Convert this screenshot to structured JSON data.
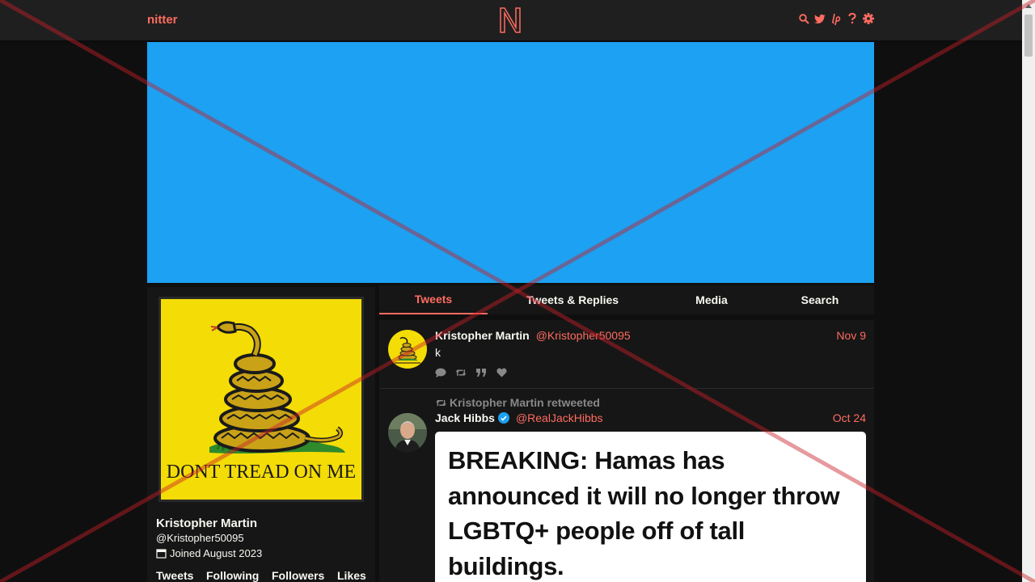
{
  "navbar": {
    "brand": "nitter",
    "icons": [
      "search-icon",
      "twitter-bird-icon",
      "liberapay-icon",
      "help-icon",
      "settings-gear-icon"
    ]
  },
  "banner": {
    "color": "#1da1f2"
  },
  "profile": {
    "avatar_caption": "DONT TREAD ON ME",
    "fullname": "Kristopher Martin",
    "username": "@Kristopher50095",
    "joined": "Joined August 2023",
    "stats": [
      "Tweets",
      "Following",
      "Followers",
      "Likes"
    ]
  },
  "tabs": [
    "Tweets",
    "Tweets & Replies",
    "Media",
    "Search"
  ],
  "active_tab": "Tweets",
  "tweets": [
    {
      "fullname": "Kristopher Martin",
      "handle": "@Kristopher50095",
      "date": "Nov 9",
      "text": "k",
      "actions": [
        "comment-icon",
        "retweet-icon",
        "quote-icon",
        "heart-icon"
      ]
    },
    {
      "retweet_header": "Kristopher Martin retweeted",
      "fullname": "Jack Hibbs",
      "verified": true,
      "handle": "@RealJackHibbs",
      "date": "Oct 24",
      "attachment_text": "BREAKING: Hamas has announced it will no longer throw LGBTQ+ people off of tall buildings."
    }
  ],
  "colors": {
    "accent": "#ff6c60",
    "background": "#0f0f0f",
    "panel": "#161616",
    "navbar": "#1f1f1f",
    "banner": "#1da1f2"
  }
}
